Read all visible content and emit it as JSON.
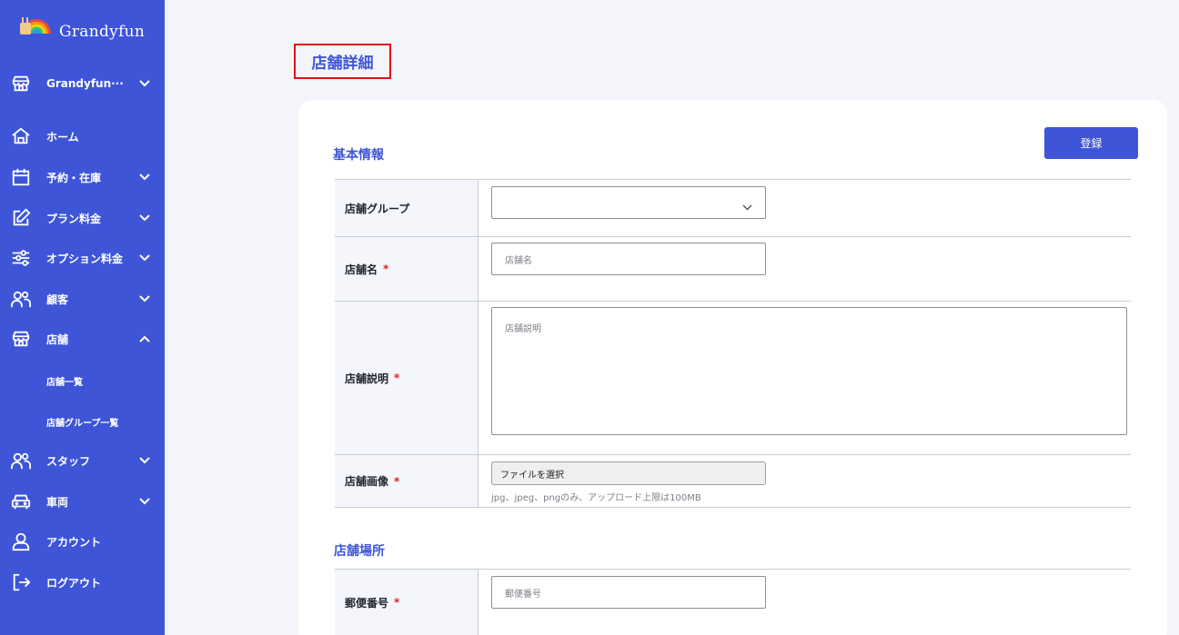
{
  "brand": {
    "name": "Grandyfun"
  },
  "sidebar": {
    "store_selector": "Grandyfun···",
    "items": [
      {
        "label": "ホーム",
        "icon": "home-icon"
      },
      {
        "label": "予約・在庫",
        "icon": "calendar-icon"
      },
      {
        "label": "プラン料金",
        "icon": "edit-icon"
      },
      {
        "label": "オプション料金",
        "icon": "sliders-icon"
      },
      {
        "label": "顧客",
        "icon": "users-icon"
      },
      {
        "label": "店舗",
        "icon": "store-icon"
      },
      {
        "label": "スタッフ",
        "icon": "users-icon"
      },
      {
        "label": "車両",
        "icon": "car-icon"
      },
      {
        "label": "アカウント",
        "icon": "user-icon"
      },
      {
        "label": "ログアウト",
        "icon": "logout-icon"
      }
    ],
    "sub_items": [
      {
        "label": "店舗一覧"
      },
      {
        "label": "店舗グループ一覧"
      }
    ]
  },
  "page": {
    "title": "店舗詳細"
  },
  "basic_section": {
    "title": "基本情報"
  },
  "actions": {
    "register_label": "登録"
  },
  "form": {
    "required_mark": "*",
    "group": {
      "label": "店舗グループ",
      "value": ""
    },
    "name": {
      "label": "店舗名",
      "placeholder": "店舗名"
    },
    "description": {
      "label": "店舗説明",
      "placeholder": "店舗説明"
    },
    "image": {
      "label": "店舗画像",
      "button": "ファイルを選択",
      "hint": "jpg、jpeg、pngのみ、アップロード上限は100MB"
    }
  },
  "location_section": {
    "title": "店舗場所"
  },
  "location_form": {
    "postal": {
      "label": "郵便番号",
      "placeholder": "郵便番号"
    }
  },
  "colors": {
    "accent": "#3e55d8",
    "required": "#e02020",
    "highlight": "#e01010"
  }
}
